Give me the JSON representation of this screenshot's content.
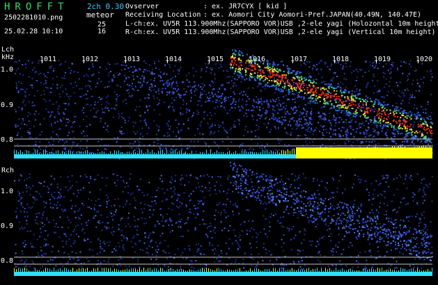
{
  "header": {
    "app_name": "HROFFT",
    "version": "2ch 0.30",
    "meteor_label": "meteor",
    "filename": "2502281010.png",
    "datetime": "25.02.28 10:10",
    "lch_count": "25",
    "rch_count": "16",
    "observer_key": "Ovserver",
    "observer_val": ": ex. JR7CYX [ kid ]",
    "location_key": "Receiving Location",
    "location_val": ": ex. Aomori City Aomori-Pref.JAPAN(40.49N, 140.47E)",
    "lch_line": "L-ch:ex. UV5R 113.900Mhz(SAPPORO VOR)USB ,2-ele yagi (Holozontal 10m height)",
    "rch_line": "R-ch:ex. UV5R 113.900Mhz(SAPPORO VOR)USB ,2-ele yagi (Vertical 10m height)"
  },
  "lch": {
    "label": "Lch",
    "unit": "kHz",
    "yticks": [
      "1.0",
      "0.9",
      "0.8"
    ],
    "minute_ticks": [
      "1011",
      "1012",
      "1013",
      "1014",
      "1015",
      "1016",
      "1017",
      "1018",
      "1019",
      "1020"
    ]
  },
  "rch": {
    "label": "Rch",
    "yticks": [
      "1.0",
      "0.9",
      "0.8"
    ]
  },
  "colors": {
    "background": "#000000",
    "noise": "#1a2a9a",
    "trace_hot": "#ff3020",
    "trace_warm": "#f0e040",
    "baseline_cyan": "#30e0ff",
    "baseline_yellow": "#ffff00",
    "title_green": "#2ee06a",
    "version_cyan": "#3ac8ff"
  }
}
